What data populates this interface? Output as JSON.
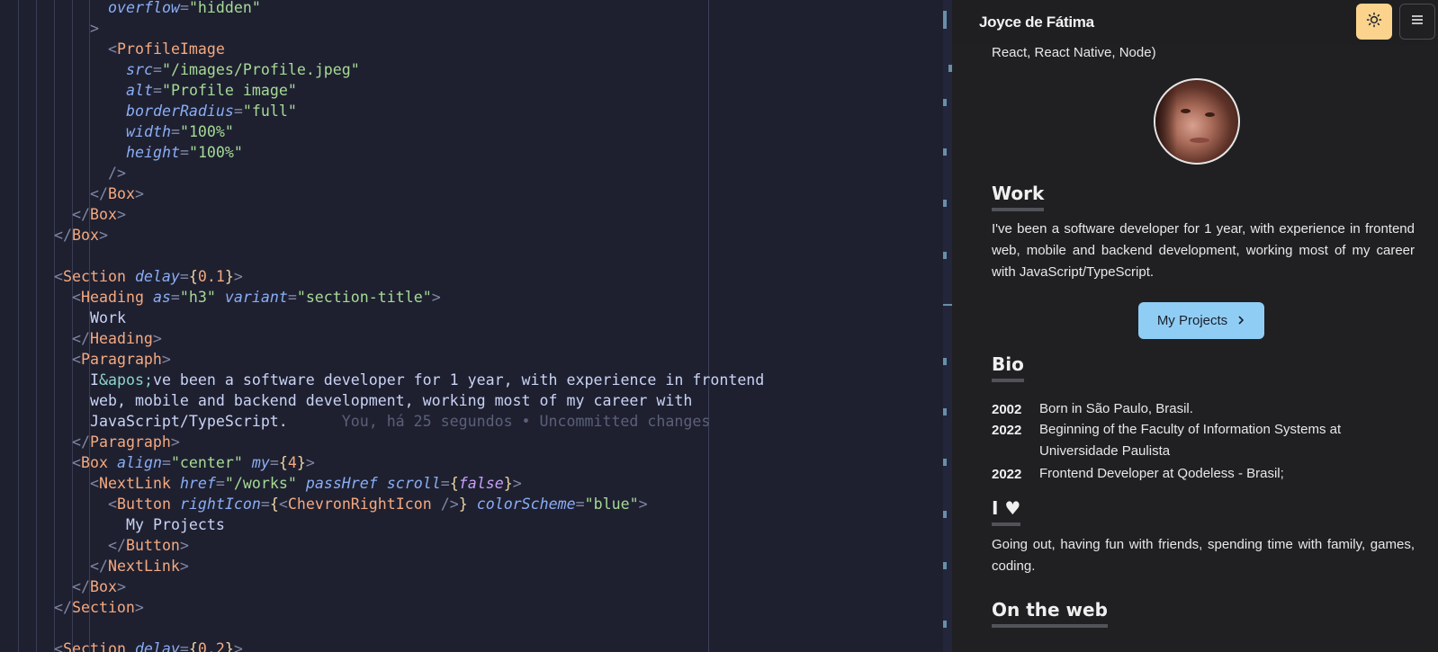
{
  "editor": {
    "lines": [
      {
        "tokens": [
          [
            "attr",
            "overflow"
          ],
          [
            "punc",
            "="
          ],
          [
            "str",
            "\"hidden\""
          ]
        ]
      },
      {
        "tokens": [
          [
            "punc",
            ">"
          ]
        ]
      },
      {
        "tokens": [
          [
            "punc",
            "<"
          ],
          [
            "tag",
            "ProfileImage"
          ]
        ]
      },
      {
        "tokens": [
          [
            "attr",
            "src"
          ],
          [
            "punc",
            "="
          ],
          [
            "str",
            "\"/images/Profile.jpeg\""
          ]
        ]
      },
      {
        "tokens": [
          [
            "attr",
            "alt"
          ],
          [
            "punc",
            "="
          ],
          [
            "str",
            "\"Profile image\""
          ]
        ]
      },
      {
        "tokens": [
          [
            "attr",
            "borderRadius"
          ],
          [
            "punc",
            "="
          ],
          [
            "str",
            "\"full\""
          ]
        ]
      },
      {
        "tokens": [
          [
            "attr",
            "width"
          ],
          [
            "punc",
            "="
          ],
          [
            "str",
            "\"100%\""
          ]
        ]
      },
      {
        "tokens": [
          [
            "attr",
            "height"
          ],
          [
            "punc",
            "="
          ],
          [
            "str",
            "\"100%\""
          ]
        ]
      },
      {
        "tokens": [
          [
            "punc",
            "/>"
          ]
        ]
      },
      {
        "tokens": [
          [
            "punc",
            "</"
          ],
          [
            "tag",
            "Box"
          ],
          [
            "punc",
            ">"
          ]
        ]
      },
      {
        "tokens": [
          [
            "punc",
            "</"
          ],
          [
            "tag",
            "Box"
          ],
          [
            "punc",
            ">"
          ]
        ]
      },
      {
        "tokens": [
          [
            "punc",
            "</"
          ],
          [
            "tag",
            "Box"
          ],
          [
            "punc",
            ">"
          ]
        ]
      },
      {
        "tokens": []
      },
      {
        "tokens": [
          [
            "punc",
            "<"
          ],
          [
            "tag",
            "Section"
          ],
          [
            "text",
            " "
          ],
          [
            "attr",
            "delay"
          ],
          [
            "punc",
            "="
          ],
          [
            "brace",
            "{"
          ],
          [
            "num",
            "0.1"
          ],
          [
            "brace",
            "}"
          ],
          [
            "punc",
            ">"
          ]
        ]
      },
      {
        "tokens": [
          [
            "punc",
            "<"
          ],
          [
            "tag",
            "Heading"
          ],
          [
            "text",
            " "
          ],
          [
            "attr",
            "as"
          ],
          [
            "punc",
            "="
          ],
          [
            "str",
            "\"h3\""
          ],
          [
            "text",
            " "
          ],
          [
            "attr",
            "variant"
          ],
          [
            "punc",
            "="
          ],
          [
            "str",
            "\"section-title\""
          ],
          [
            "punc",
            ">"
          ]
        ]
      },
      {
        "tokens": [
          [
            "text",
            "Work"
          ]
        ]
      },
      {
        "tokens": [
          [
            "punc",
            "</"
          ],
          [
            "tag",
            "Heading"
          ],
          [
            "punc",
            ">"
          ]
        ]
      },
      {
        "tokens": [
          [
            "punc",
            "<"
          ],
          [
            "tag",
            "Paragraph"
          ],
          [
            "punc",
            ">"
          ]
        ]
      },
      {
        "tokens": [
          [
            "text",
            "I"
          ],
          [
            "ent",
            "&apos;"
          ],
          [
            "text",
            "ve been a software developer for 1 year, with experience in frontend"
          ]
        ]
      },
      {
        "tokens": [
          [
            "text",
            "web, mobile and backend development, working most of my career with"
          ]
        ]
      },
      {
        "tokens": [
          [
            "text",
            "JavaScript/TypeScript."
          ],
          [
            "ghost",
            "      You, há 25 segundos • Uncommitted changes"
          ]
        ]
      },
      {
        "tokens": [
          [
            "punc",
            "</"
          ],
          [
            "tag",
            "Paragraph"
          ],
          [
            "punc",
            ">"
          ]
        ]
      },
      {
        "tokens": [
          [
            "punc",
            "<"
          ],
          [
            "tag",
            "Box"
          ],
          [
            "text",
            " "
          ],
          [
            "attr",
            "align"
          ],
          [
            "punc",
            "="
          ],
          [
            "str",
            "\"center\""
          ],
          [
            "text",
            " "
          ],
          [
            "attr",
            "my"
          ],
          [
            "punc",
            "="
          ],
          [
            "brace",
            "{"
          ],
          [
            "num",
            "4"
          ],
          [
            "brace",
            "}"
          ],
          [
            "punc",
            ">"
          ]
        ]
      },
      {
        "tokens": [
          [
            "punc",
            "<"
          ],
          [
            "tag",
            "NextLink"
          ],
          [
            "text",
            " "
          ],
          [
            "attr",
            "href"
          ],
          [
            "punc",
            "="
          ],
          [
            "str",
            "\"/works\""
          ],
          [
            "text",
            " "
          ],
          [
            "attr",
            "passHref"
          ],
          [
            "text",
            " "
          ],
          [
            "attr",
            "scroll"
          ],
          [
            "punc",
            "="
          ],
          [
            "brace",
            "{"
          ],
          [
            "kw",
            "false"
          ],
          [
            "brace",
            "}"
          ],
          [
            "punc",
            ">"
          ]
        ]
      },
      {
        "tokens": [
          [
            "punc",
            "<"
          ],
          [
            "tag",
            "Button"
          ],
          [
            "text",
            " "
          ],
          [
            "attr",
            "rightIcon"
          ],
          [
            "punc",
            "="
          ],
          [
            "brace",
            "{"
          ],
          [
            "punc",
            "<"
          ],
          [
            "tag",
            "ChevronRightIcon"
          ],
          [
            "text",
            " "
          ],
          [
            "punc",
            "/>"
          ],
          [
            "brace",
            "}"
          ],
          [
            "text",
            " "
          ],
          [
            "attr",
            "colorScheme"
          ],
          [
            "punc",
            "="
          ],
          [
            "str",
            "\"blue\""
          ],
          [
            "punc",
            ">"
          ]
        ]
      },
      {
        "tokens": [
          [
            "text",
            "My Projects"
          ]
        ]
      },
      {
        "tokens": [
          [
            "punc",
            "</"
          ],
          [
            "tag",
            "Button"
          ],
          [
            "punc",
            ">"
          ]
        ]
      },
      {
        "tokens": [
          [
            "punc",
            "</"
          ],
          [
            "tag",
            "NextLink"
          ],
          [
            "punc",
            ">"
          ]
        ]
      },
      {
        "tokens": [
          [
            "punc",
            "</"
          ],
          [
            "tag",
            "Box"
          ],
          [
            "punc",
            ">"
          ]
        ]
      },
      {
        "tokens": [
          [
            "punc",
            "</"
          ],
          [
            "tag",
            "Section"
          ],
          [
            "punc",
            ">"
          ]
        ]
      },
      {
        "tokens": []
      },
      {
        "tokens": [
          [
            "punc",
            "<"
          ],
          [
            "tag",
            "Section"
          ],
          [
            "text",
            " "
          ],
          [
            "attr",
            "delay"
          ],
          [
            "punc",
            "="
          ],
          [
            "brace",
            "{"
          ],
          [
            "num",
            "0.2"
          ],
          [
            "brace",
            "}"
          ],
          [
            "punc",
            ">"
          ]
        ]
      }
    ]
  },
  "preview": {
    "brand": "Joyce de Fátima",
    "intro_tail": "React, React Native, Node)",
    "work": {
      "title": "Work",
      "paragraph": "I've been a software developer for 1 year, with experience in frontend web, mobile and backend development, working most of my career with JavaScript/TypeScript.",
      "button_label": "My Projects"
    },
    "bio": {
      "title": "Bio",
      "entries": [
        {
          "year": "2002",
          "text": "Born in São Paulo, Brasil."
        },
        {
          "year": "2022",
          "text": "Beginning of the Faculty of Information Systems at Universidade Paulista"
        },
        {
          "year": "2022",
          "text": "Frontend Developer at Qodeless - Brasil;"
        }
      ]
    },
    "love": {
      "title": "I ♥",
      "paragraph": "Going out, having fun with friends, spending time with family, games, coding."
    },
    "web": {
      "title": "On the web"
    }
  },
  "colors": {
    "editor_bg": "#1e2030",
    "preview_bg": "#202023",
    "theme_button": "#fbd38d",
    "projects_button": "#90cdf4"
  }
}
